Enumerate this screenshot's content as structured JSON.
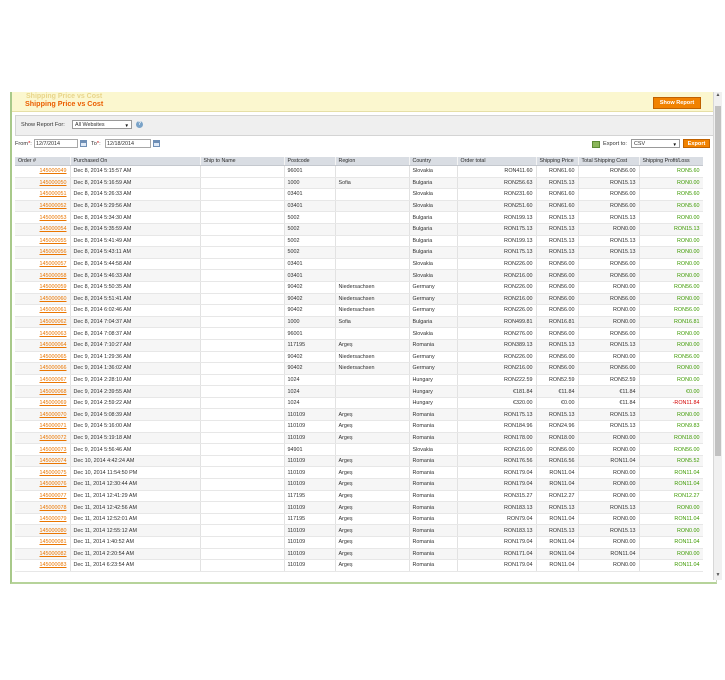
{
  "header": {
    "ghost_title": "Shipping Price vs Cost",
    "title": "Shipping Price vs Cost",
    "show_report_label": "Show Report"
  },
  "filter": {
    "show_report_for_label": "Show Report For:",
    "store_value": "All Websites",
    "help_glyph": "?"
  },
  "dates": {
    "from_label": "From",
    "from_required": "*",
    "from_colon": ":",
    "from_value": "12/7/2014",
    "to_label": "To",
    "to_required": "*",
    "to_colon": ":",
    "to_value": "12/18/2014"
  },
  "export": {
    "label": "Export to:",
    "format": "CSV",
    "button_label": "Export"
  },
  "table": {
    "columns": [
      "Order #",
      "Purchased On",
      "Ship to Name",
      "Postcode",
      "Region",
      "Country",
      "Order total",
      "Shipping Price",
      "Total Shipping Cost",
      "Shipping Profit/Loss"
    ],
    "rows": [
      [
        "145000049",
        "Dec 8, 2014 5:15:57 AM",
        "",
        "96001",
        "",
        "Slovakia",
        "RON411.60",
        "RON61.60",
        "RON56.00",
        "RON5.60"
      ],
      [
        "145000050",
        "Dec 8, 2014 5:16:59 AM",
        "",
        "1000",
        "Sofia",
        "Bulgaria",
        "RON256.63",
        "RON15.13",
        "RON15.13",
        "RON0.00"
      ],
      [
        "145000051",
        "Dec 8, 2014 5:26:33 AM",
        "",
        "03401",
        "",
        "Slovakia",
        "RON231.60",
        "RON61.60",
        "RON56.00",
        "RON5.60"
      ],
      [
        "145000052",
        "Dec 8, 2014 5:29:56 AM",
        "",
        "03401",
        "",
        "Slovakia",
        "RON251.60",
        "RON61.60",
        "RON56.00",
        "RON5.60"
      ],
      [
        "145000053",
        "Dec 8, 2014 5:34:30 AM",
        "",
        "5002",
        "",
        "Bulgaria",
        "RON199.13",
        "RON15.13",
        "RON15.13",
        "RON0.00"
      ],
      [
        "145000054",
        "Dec 8, 2014 5:35:59 AM",
        "",
        "5002",
        "",
        "Bulgaria",
        "RON175.13",
        "RON15.13",
        "RON0.00",
        "RON15.13"
      ],
      [
        "145000055",
        "Dec 8, 2014 5:41:49 AM",
        "",
        "5002",
        "",
        "Bulgaria",
        "RON199.13",
        "RON15.13",
        "RON15.13",
        "RON0.00"
      ],
      [
        "145000056",
        "Dec 8, 2014 5:43:11 AM",
        "",
        "5002",
        "",
        "Bulgaria",
        "RON175.13",
        "RON15.13",
        "RON15.13",
        "RON0.00"
      ],
      [
        "145000057",
        "Dec 8, 2014 5:44:58 AM",
        "",
        "03401",
        "",
        "Slovakia",
        "RON226.00",
        "RON56.00",
        "RON56.00",
        "RON0.00"
      ],
      [
        "145000058",
        "Dec 8, 2014 5:46:33 AM",
        "",
        "03401",
        "",
        "Slovakia",
        "RON216.00",
        "RON56.00",
        "RON56.00",
        "RON0.00"
      ],
      [
        "145000059",
        "Dec 8, 2014 5:50:35 AM",
        "",
        "90402",
        "Niedersachsen",
        "Germany",
        "RON226.00",
        "RON56.00",
        "RON0.00",
        "RON56.00"
      ],
      [
        "145000060",
        "Dec 8, 2014 5:51:41 AM",
        "",
        "90402",
        "Niedersachsen",
        "Germany",
        "RON216.00",
        "RON56.00",
        "RON56.00",
        "RON0.00"
      ],
      [
        "145000061",
        "Dec 8, 2014 6:02:46 AM",
        "",
        "90402",
        "Niedersachsen",
        "Germany",
        "RON226.00",
        "RON56.00",
        "RON0.00",
        "RON56.00"
      ],
      [
        "145000062",
        "Dec 8, 2014 7:04:37 AM",
        "",
        "1000",
        "Sofia",
        "Bulgaria",
        "RON499.81",
        "RON16.81",
        "RON0.00",
        "RON16.81"
      ],
      [
        "145000063",
        "Dec 8, 2014 7:08:37 AM",
        "",
        "96001",
        "",
        "Slovakia",
        "RON276.00",
        "RON56.00",
        "RON56.00",
        "RON0.00"
      ],
      [
        "145000064",
        "Dec 8, 2014 7:10:27 AM",
        "",
        "117195",
        "Argeș",
        "Romania",
        "RON389.13",
        "RON15.13",
        "RON15.13",
        "RON0.00"
      ],
      [
        "145000065",
        "Dec 9, 2014 1:29:36 AM",
        "",
        "90402",
        "Niedersachsen",
        "Germany",
        "RON226.00",
        "RON56.00",
        "RON0.00",
        "RON56.00"
      ],
      [
        "145000066",
        "Dec 9, 2014 1:36:02 AM",
        "",
        "90402",
        "Niedersachsen",
        "Germany",
        "RON216.00",
        "RON56.00",
        "RON56.00",
        "RON0.00"
      ],
      [
        "145000067",
        "Dec 9, 2014 2:28:10 AM",
        "",
        "1024",
        "",
        "Hungary",
        "RON222.59",
        "RON52.59",
        "RON52.59",
        "RON0.00"
      ],
      [
        "145000068",
        "Dec 9, 2014 2:39:55 AM",
        "",
        "1024",
        "",
        "Hungary",
        "€181.84",
        "€11.84",
        "€11.84",
        "€0.00"
      ],
      [
        "145000069",
        "Dec 9, 2014 2:59:22 AM",
        "",
        "1024",
        "",
        "Hungary",
        "€320.00",
        "€0.00",
        "€11.84",
        "-RON11.84"
      ],
      [
        "145000070",
        "Dec 9, 2014 5:08:39 AM",
        "",
        "110109",
        "Argeș",
        "Romania",
        "RON175.13",
        "RON15.13",
        "RON15.13",
        "RON0.00"
      ],
      [
        "145000071",
        "Dec 9, 2014 5:16:00 AM",
        "",
        "110109",
        "Argeș",
        "Romania",
        "RON184.96",
        "RON24.96",
        "RON15.13",
        "RON9.83"
      ],
      [
        "145000072",
        "Dec 9, 2014 5:19:18 AM",
        "",
        "110109",
        "Argeș",
        "Romania",
        "RON178.00",
        "RON18.00",
        "RON0.00",
        "RON18.00"
      ],
      [
        "145000073",
        "Dec 9, 2014 5:56:46 AM",
        "",
        "94901",
        "",
        "Slovakia",
        "RON216.00",
        "RON56.00",
        "RON0.00",
        "RON56.00"
      ],
      [
        "145000074",
        "Dec 10, 2014 4:42:24 AM",
        "",
        "110109",
        "Argeș",
        "Romania",
        "RON176.56",
        "RON16.56",
        "RON11.04",
        "RON5.52"
      ],
      [
        "145000075",
        "Dec 10, 2014 11:54:50 PM",
        "",
        "110109",
        "Argeș",
        "Romania",
        "RON179.04",
        "RON11.04",
        "RON0.00",
        "RON11.04"
      ],
      [
        "145000076",
        "Dec 11, 2014 12:30:44 AM",
        "",
        "110109",
        "Argeș",
        "Romania",
        "RON179.04",
        "RON11.04",
        "RON0.00",
        "RON11.04"
      ],
      [
        "145000077",
        "Dec 11, 2014 12:41:29 AM",
        "",
        "117195",
        "Argeș",
        "Romania",
        "RON315.27",
        "RON12.27",
        "RON0.00",
        "RON12.27"
      ],
      [
        "145000078",
        "Dec 11, 2014 12:42:56 AM",
        "",
        "110109",
        "Argeș",
        "Romania",
        "RON183.13",
        "RON15.13",
        "RON15.13",
        "RON0.00"
      ],
      [
        "145000079",
        "Dec 11, 2014 12:52:01 AM",
        "",
        "117195",
        "Argeș",
        "Romania",
        "RON79.04",
        "RON11.04",
        "RON0.00",
        "RON11.04"
      ],
      [
        "145000080",
        "Dec 11, 2014 12:55:12 AM",
        "",
        "110109",
        "Argeș",
        "Romania",
        "RON183.13",
        "RON15.13",
        "RON15.13",
        "RON0.00"
      ],
      [
        "145000081",
        "Dec 11, 2014 1:40:52 AM",
        "",
        "110109",
        "Argeș",
        "Romania",
        "RON179.04",
        "RON11.04",
        "RON0.00",
        "RON11.04"
      ],
      [
        "145000082",
        "Dec 11, 2014 2:20:54 AM",
        "",
        "110109",
        "Argeș",
        "Romania",
        "RON171.04",
        "RON11.04",
        "RON11.04",
        "RON0.00"
      ],
      [
        "145000083",
        "Dec 11, 2014 6:23:54 AM",
        "",
        "110109",
        "Argeș",
        "Romania",
        "RON179.04",
        "RON11.04",
        "RON0.00",
        "RON11.04"
      ]
    ]
  },
  "colors": {
    "title_orange": "#eb5e00",
    "button_orange": "#f18200",
    "link_orange": "#ea7601",
    "profit_green": "#3d9a00",
    "loss_red": "#d40000",
    "header_bg": "#fbf7cf"
  },
  "icons": {
    "help": "help-icon",
    "calendar": "calendar-icon",
    "export": "export-icon",
    "dropdown": "chevron-down-icon"
  }
}
